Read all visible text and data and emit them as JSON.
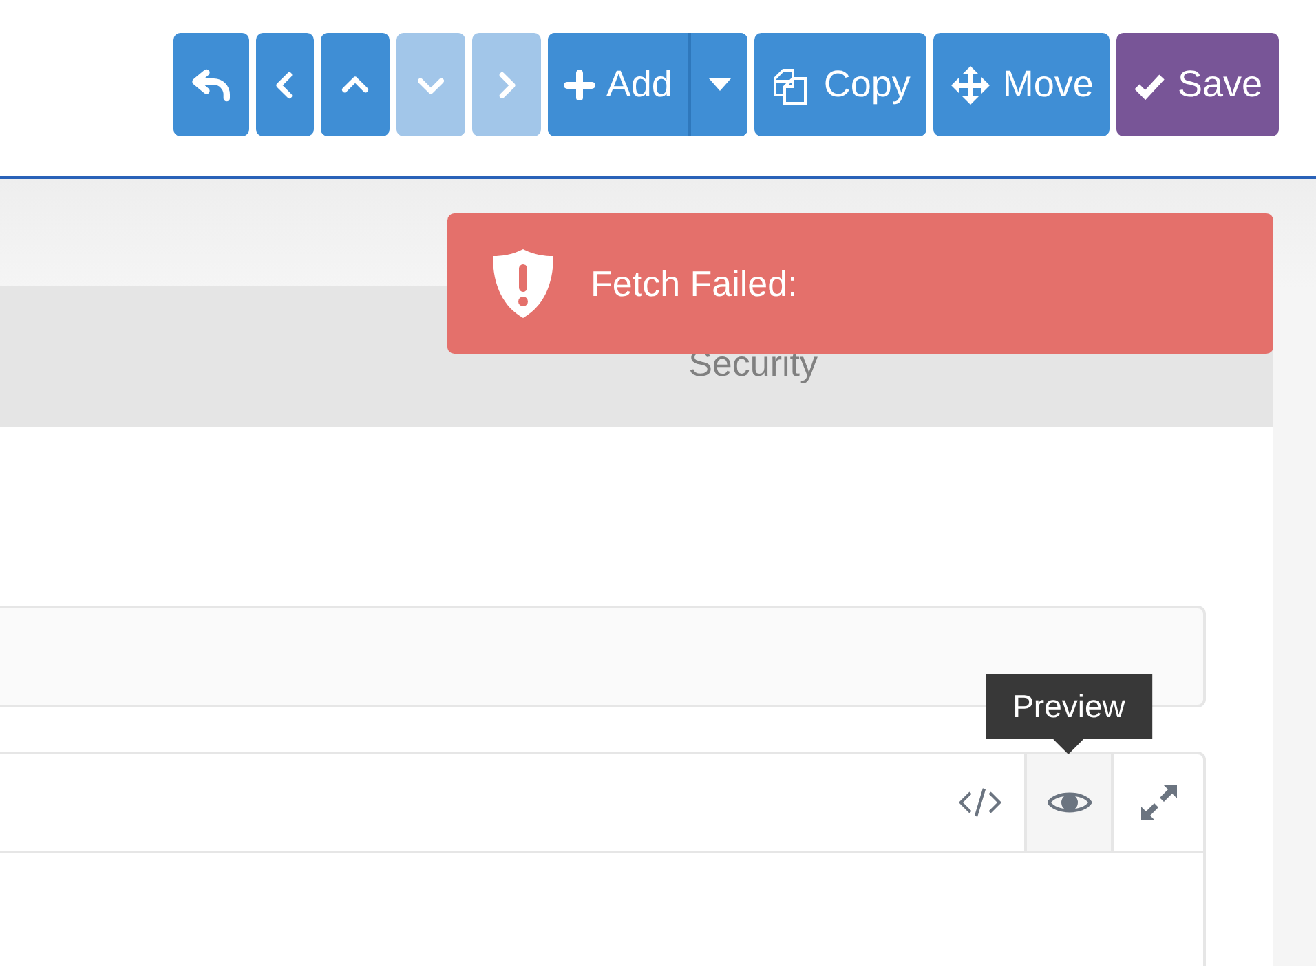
{
  "toolbar": {
    "buttons": [
      {
        "kind": "icon",
        "disabled": false
      },
      {
        "kind": "icon",
        "disabled": false
      },
      {
        "kind": "icon",
        "disabled": false
      },
      {
        "kind": "icon",
        "disabled": true
      },
      {
        "kind": "icon",
        "disabled": true
      },
      {
        "kind": "split",
        "label": "Add",
        "disabled": false
      },
      {
        "kind": "label",
        "label": "Copy",
        "disabled": false
      },
      {
        "kind": "label",
        "label": "Move",
        "disabled": false
      },
      {
        "kind": "save",
        "label": "Save",
        "disabled": false
      }
    ]
  },
  "toast": {
    "message": "Fetch Failed:"
  },
  "tabs": [
    {
      "label": "Security"
    }
  ],
  "editor": {
    "tools": [
      {
        "selected": false
      },
      {
        "selected": true
      },
      {
        "selected": false
      }
    ],
    "tooltip": "Preview"
  }
}
